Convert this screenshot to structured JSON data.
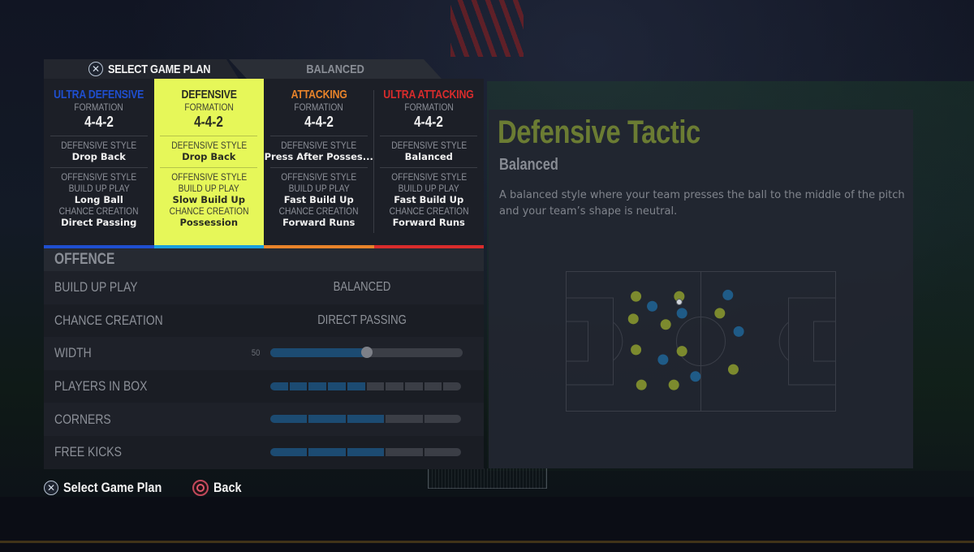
{
  "header": {
    "select_game_plan_label": "SELECT GAME PLAN",
    "select_button_icon": "cross-button-icon",
    "current_plan_label": "BALANCED"
  },
  "plans": [
    {
      "name": "ULTRA DEFENSIVE",
      "color": "#1f4fd0",
      "formation_label": "FORMATION",
      "formation": "4-4-2",
      "defensive_style_label": "DEFENSIVE STYLE",
      "defensive_style": "Drop Back",
      "offensive_style_label": "OFFENSIVE STYLE",
      "build_up_play_label": "BUILD UP PLAY",
      "build_up_play": "Long Ball",
      "chance_creation_label": "CHANCE CREATION",
      "chance_creation": "Direct Passing",
      "selected": false
    },
    {
      "name": "DEFENSIVE",
      "color": "#1aa0de",
      "formation_label": "FORMATION",
      "formation": "4-4-2",
      "defensive_style_label": "DEFENSIVE STYLE",
      "defensive_style": "Drop Back",
      "offensive_style_label": "OFFENSIVE STYLE",
      "build_up_play_label": "BUILD UP PLAY",
      "build_up_play": "Slow Build Up",
      "chance_creation_label": "CHANCE CREATION",
      "chance_creation": "Possession",
      "selected": true
    },
    {
      "name": "ATTACKING",
      "color": "#e8832a",
      "formation_label": "FORMATION",
      "formation": "4-4-2",
      "defensive_style_label": "DEFENSIVE STYLE",
      "defensive_style": "Press After Posses...",
      "offensive_style_label": "OFFENSIVE STYLE",
      "build_up_play_label": "BUILD UP PLAY",
      "build_up_play": "Fast Build Up",
      "chance_creation_label": "CHANCE CREATION",
      "chance_creation": "Forward Runs",
      "selected": false
    },
    {
      "name": "ULTRA ATTACKING",
      "color": "#d92c2c",
      "formation_label": "FORMATION",
      "formation": "4-4-2",
      "defensive_style_label": "DEFENSIVE STYLE",
      "defensive_style": "Balanced",
      "offensive_style_label": "OFFENSIVE STYLE",
      "build_up_play_label": "BUILD UP PLAY",
      "build_up_play": "Fast Build Up",
      "chance_creation_label": "CHANCE CREATION",
      "chance_creation": "Forward Runs",
      "selected": false
    }
  ],
  "offence": {
    "section_label": "OFFENCE",
    "build_up_play": {
      "label": "BUILD UP PLAY",
      "value": "BALANCED"
    },
    "chance_creation": {
      "label": "CHANCE CREATION",
      "value": "DIRECT PASSING"
    },
    "width": {
      "label": "WIDTH",
      "value": 50,
      "value_text": "50",
      "max": 100
    },
    "players_in_box": {
      "label": "PLAYERS IN BOX",
      "filled": 5,
      "total": 10
    },
    "corners": {
      "label": "CORNERS",
      "filled": 3,
      "total": 5
    },
    "free_kicks": {
      "label": "FREE KICKS",
      "filled": 3,
      "total": 5
    }
  },
  "info": {
    "title": "Defensive Tactic",
    "subtitle": "Balanced",
    "description": "A balanced style where your team presses the ball to the middle of the pitch and your team’s shape is neutral.",
    "pitch": {
      "team_color": "#7c8a2e",
      "opponent_color": "#1f5b87",
      "team_players": [
        [
          0.26,
          0.18
        ],
        [
          0.42,
          0.18
        ],
        [
          0.25,
          0.34
        ],
        [
          0.37,
          0.38
        ],
        [
          0.26,
          0.56
        ],
        [
          0.43,
          0.57
        ],
        [
          0.28,
          0.81
        ],
        [
          0.4,
          0.81
        ],
        [
          0.57,
          0.3
        ],
        [
          0.62,
          0.7
        ]
      ],
      "opponent_players": [
        [
          0.32,
          0.25
        ],
        [
          0.43,
          0.3
        ],
        [
          0.36,
          0.63
        ],
        [
          0.48,
          0.75
        ],
        [
          0.6,
          0.17
        ],
        [
          0.64,
          0.43
        ]
      ],
      "ball": [
        0.42,
        0.22
      ]
    }
  },
  "footer": {
    "select_label": "Select Game Plan",
    "select_icon": "cross-button-icon",
    "back_label": "Back",
    "back_icon": "circle-button-icon"
  }
}
